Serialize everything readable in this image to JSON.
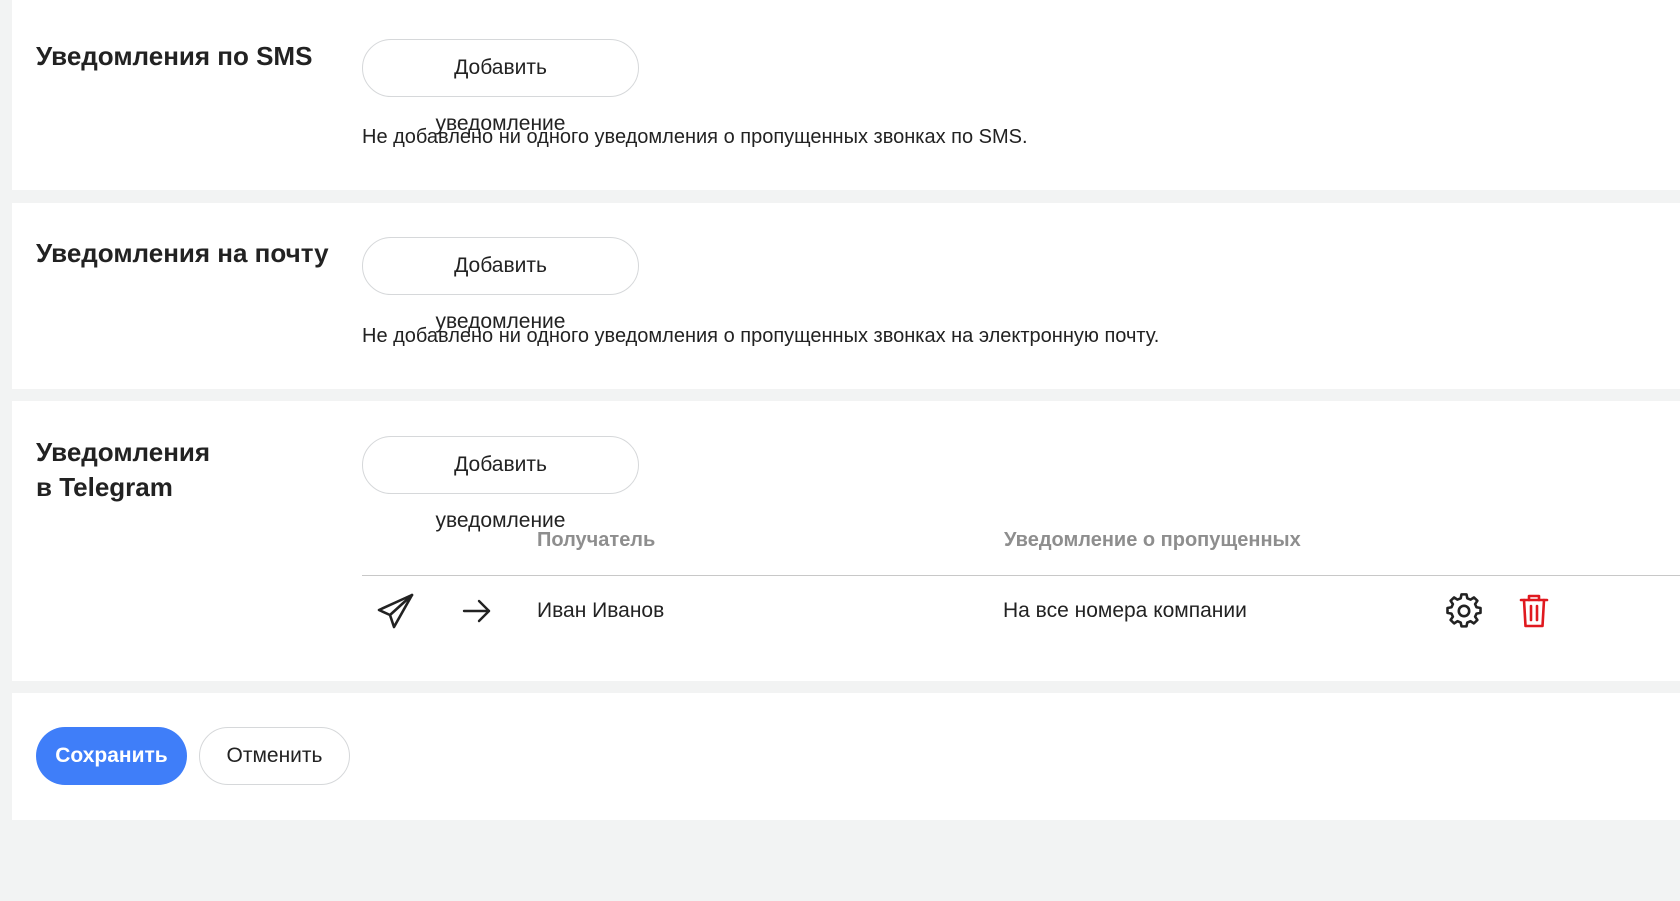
{
  "sms": {
    "title": "Уведомления по SMS",
    "add_button": "Добавить уведомление",
    "empty_text": "Не добавлено ни одного уведомления о пропущенных звонках по SMS."
  },
  "email": {
    "title": "Уведомления на почту",
    "add_button": "Добавить уведомление",
    "empty_text": "Не добавлено ни одного уведомления о пропущенных звонках на электронную почту."
  },
  "telegram": {
    "title_line1": "Уведомления",
    "title_line2": "в Telegram",
    "add_button": "Добавить уведомление",
    "columns": [
      "Получатель",
      "Уведомление о пропущенных"
    ],
    "rows": [
      {
        "icon": "telegram-plane-icon",
        "arrow_icon": "arrow-right-icon",
        "recipient": "Иван Иванов",
        "scope": "На все номера компании",
        "settings_icon": "gear-icon",
        "delete_icon": "trash-icon"
      }
    ]
  },
  "actions": {
    "save_label": "Сохранить",
    "cancel_label": "Отменить"
  },
  "colors": {
    "primary": "#3f7ef9",
    "danger": "#e0191f",
    "background": "#f2f3f3",
    "muted_text": "#8e8e8e"
  }
}
